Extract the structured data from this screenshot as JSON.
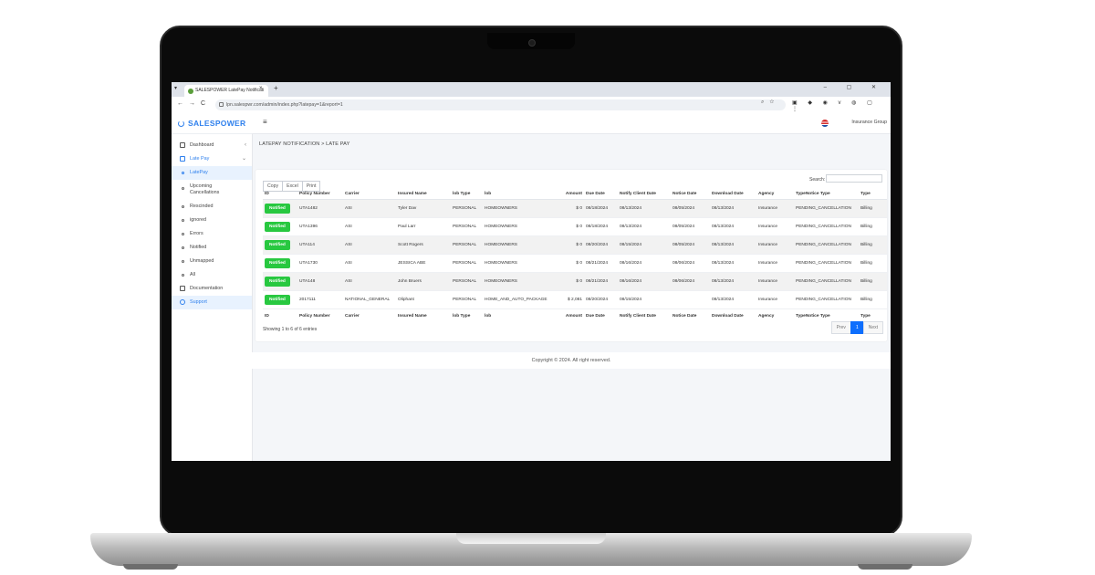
{
  "browser": {
    "tab_title": "SALESPOWER LatePay Notificati",
    "tab_close": "×",
    "new_tab": "+",
    "url": "lpn.salespwr.com/admin/index.php?latepay=1&report=1"
  },
  "app": {
    "brand": "SALESPOWER",
    "organization": "Insurance Group",
    "menu_icon": "≡"
  },
  "sidebar": {
    "items": [
      {
        "label": "Dashboard",
        "icon": "home-icon"
      },
      {
        "label": "Late Pay",
        "icon": "grid-icon"
      },
      {
        "label": "LatePay",
        "icon": "circle-icon"
      },
      {
        "label_line1": "Upcoming",
        "label_line2": "Cancellations",
        "icon": "circle-icon"
      },
      {
        "label": "Rescinded",
        "icon": "circle-icon"
      },
      {
        "label": "ignored",
        "icon": "circle-icon"
      },
      {
        "label": "Errors",
        "icon": "circle-icon"
      },
      {
        "label": "Notified",
        "icon": "circle-icon"
      },
      {
        "label": "Unmapped",
        "icon": "circle-icon"
      },
      {
        "label": "All",
        "icon": "circle-icon"
      },
      {
        "label": "Documentation",
        "icon": "folder-icon"
      },
      {
        "label": "Support",
        "icon": "headset-icon"
      }
    ]
  },
  "breadcrumb": "LATEPAY NOTIFICATION > LATE PAY",
  "toolbar": {
    "copy": "Copy",
    "excel": "Excel",
    "print": "Print",
    "search_label": "Search:"
  },
  "table": {
    "columns": [
      "ID",
      "Policy Number",
      "Carrier",
      "Insured Name",
      "lob Type",
      "lob",
      "Amount",
      "Due Date",
      "Notify Client Date",
      "Notice Date",
      "Download Date",
      "Agency",
      "TypeNotice Type",
      "Type"
    ],
    "rows": [
      {
        "id": "Notified",
        "policy": "UTA1482",
        "carrier": "ASI",
        "insured": "Tyler Dav",
        "lob_type": "PERSONAL",
        "lob": "HOMEOWNERS",
        "amount": "$ 0",
        "due": "08/18/2024",
        "notify": "08/13/2024",
        "notice": "08/05/2024",
        "download": "08/13/2024",
        "agency": "Insurance",
        "notice_type": "PENDING_CANCELLATION",
        "type": "Billing"
      },
      {
        "id": "Notified",
        "policy": "UTA1396",
        "carrier": "ASI",
        "insured": "Paul Larr",
        "lob_type": "PERSONAL",
        "lob": "HOMEOWNERS",
        "amount": "$ 0",
        "due": "08/18/2024",
        "notify": "08/13/2024",
        "notice": "08/05/2024",
        "download": "08/13/2024",
        "agency": "Insurance",
        "notice_type": "PENDING_CANCELLATION",
        "type": "Billing"
      },
      {
        "id": "Notified",
        "policy": "UTA114",
        "carrier": "ASI",
        "insured": "Scott Rogers",
        "lob_type": "PERSONAL",
        "lob": "HOMEOWNERS",
        "amount": "$ 0",
        "due": "08/20/2024",
        "notify": "08/15/2024",
        "notice": "08/05/2024",
        "download": "08/13/2024",
        "agency": "Insurance",
        "notice_type": "PENDING_CANCELLATION",
        "type": "Billing"
      },
      {
        "id": "Notified",
        "policy": "UTA1730",
        "carrier": "ASI",
        "insured": "JESSICA ABE",
        "lob_type": "PERSONAL",
        "lob": "HOMEOWNERS",
        "amount": "$ 0",
        "due": "08/21/2024",
        "notify": "08/16/2024",
        "notice": "08/06/2024",
        "download": "08/13/2024",
        "agency": "Insurance",
        "notice_type": "PENDING_CANCELLATION",
        "type": "Billing"
      },
      {
        "id": "Notified",
        "policy": "UTA148",
        "carrier": "ASI",
        "insured": "John Bruers",
        "lob_type": "PERSONAL",
        "lob": "HOMEOWNERS",
        "amount": "$ 0",
        "due": "08/21/2024",
        "notify": "08/16/2024",
        "notice": "08/06/2024",
        "download": "08/13/2024",
        "agency": "Insurance",
        "notice_type": "PENDING_CANCELLATION",
        "type": "Billing"
      },
      {
        "id": "Notified",
        "policy": "2017111",
        "carrier": "NATIONAL_GENERAL",
        "insured": "Oliphant",
        "lob_type": "PERSONAL",
        "lob": "HOME_AND_AUTO_PACKAGE",
        "amount": "$ 2,081",
        "due": "08/20/2024",
        "notify": "08/15/2024",
        "notice": "",
        "download": "08/13/2024",
        "agency": "Insurance",
        "notice_type": "PENDING_CANCELLATION",
        "type": "Billing"
      }
    ]
  },
  "pagination": {
    "info": "Showing 1 to 6 of 6 entries",
    "prev": "Prev",
    "page": "1",
    "next": "Next"
  },
  "footer": "Copyright © 2024. All right reserved.",
  "colors": {
    "accent": "#2f80ed",
    "notified": "#28c840",
    "page_active": "#0d6efd"
  }
}
